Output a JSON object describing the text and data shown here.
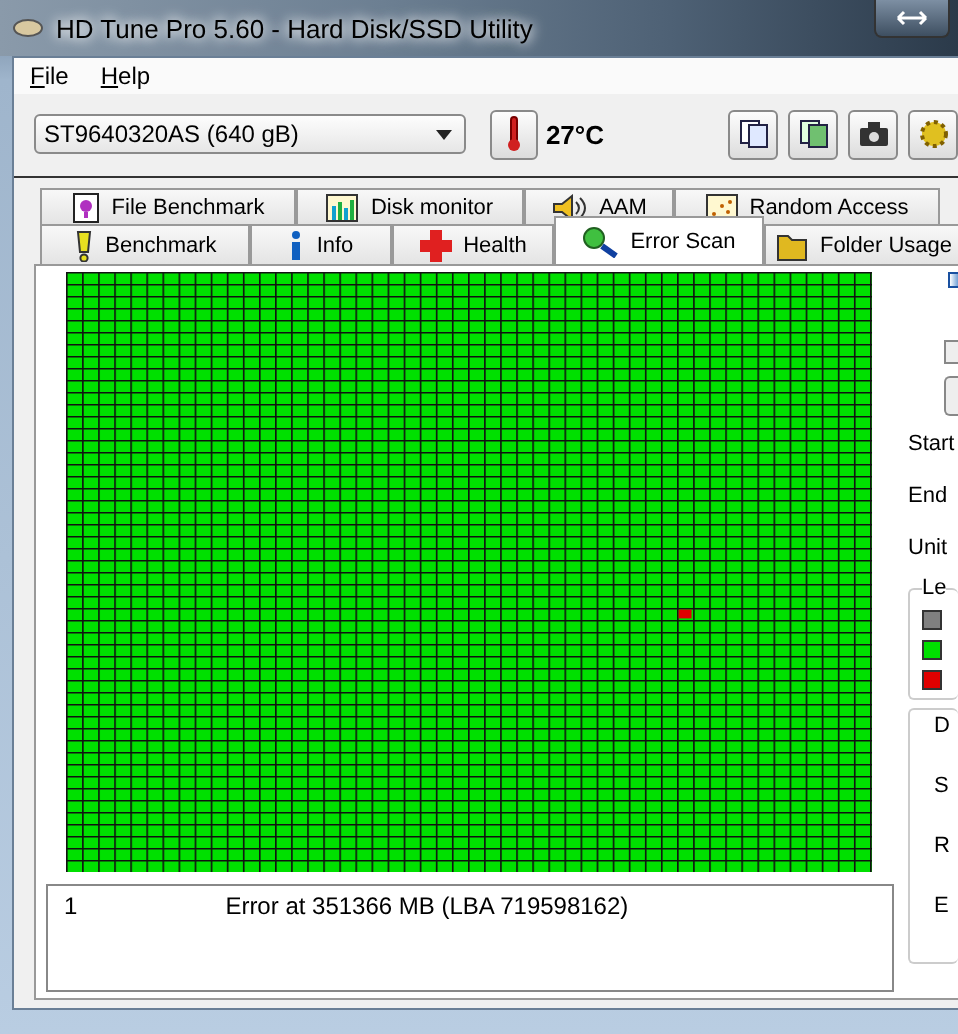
{
  "window": {
    "title": "HD Tune Pro 5.60 - Hard Disk/SSD Utility"
  },
  "menu": [
    {
      "label": "File"
    },
    {
      "label": "Help"
    }
  ],
  "toolbar": {
    "drive": "ST9640320AS (640 gB)",
    "temperature": "27°C"
  },
  "tabs_top": [
    {
      "label": "File Benchmark",
      "selected": false
    },
    {
      "label": "Disk monitor",
      "selected": false
    },
    {
      "label": "AAM",
      "selected": false
    },
    {
      "label": "Random Access",
      "selected": false
    }
  ],
  "tabs_bottom": [
    {
      "label": "Benchmark",
      "selected": false
    },
    {
      "label": "Info",
      "selected": false
    },
    {
      "label": "Health",
      "selected": false
    },
    {
      "label": "Error Scan",
      "selected": true
    },
    {
      "label": "Folder Usage",
      "selected": false
    }
  ],
  "errors": [
    {
      "number": "1",
      "message": "Error at 351366 MB (LBA 719598162)"
    }
  ],
  "checkbox": {
    "checked": false
  },
  "side_labels": [
    "Start",
    "End",
    "Unit"
  ],
  "legend": {
    "title": "Le",
    "items": [
      {
        "color": "#808080"
      },
      {
        "color": "#00e000"
      },
      {
        "color": "#e00000"
      }
    ]
  },
  "stats_labels": [
    "D",
    "S",
    "R",
    "E"
  ]
}
